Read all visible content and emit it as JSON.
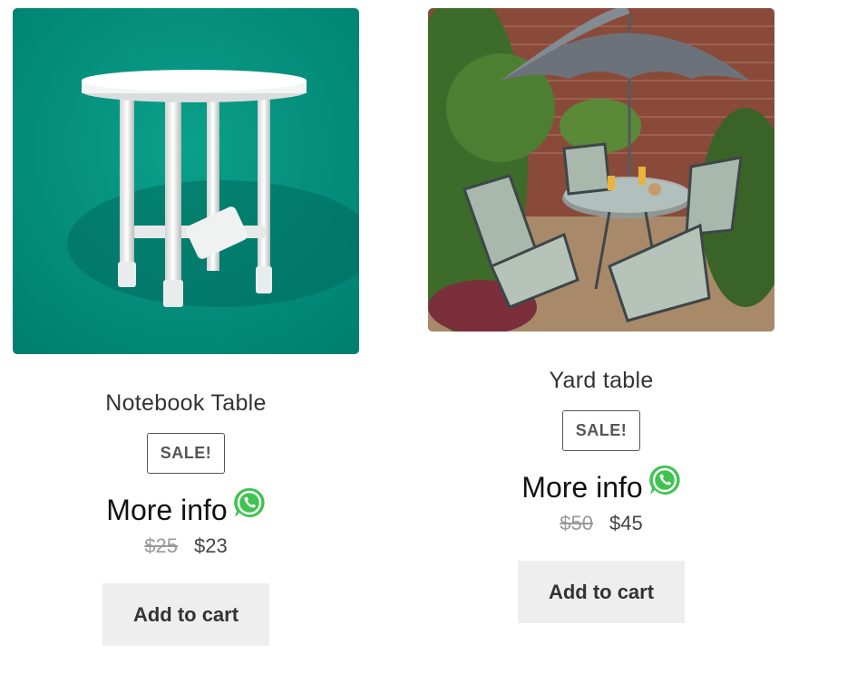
{
  "products": [
    {
      "title": "Notebook Table",
      "badge": "SALE!",
      "more_info": "More info",
      "old_price": "$25",
      "new_price": "$23",
      "cart_label": "Add to cart",
      "image_icon": "white-table-image"
    },
    {
      "title": "Yard table",
      "badge": "SALE!",
      "more_info": "More info",
      "old_price": "$50",
      "new_price": "$45",
      "cart_label": "Add to cart",
      "image_icon": "patio-set-image"
    }
  ],
  "colors": {
    "teal_background": "#00897b",
    "whatsapp_green": "#40c351",
    "button_bg": "#eeeeee"
  },
  "icons": [
    "whatsapp-icon"
  ]
}
